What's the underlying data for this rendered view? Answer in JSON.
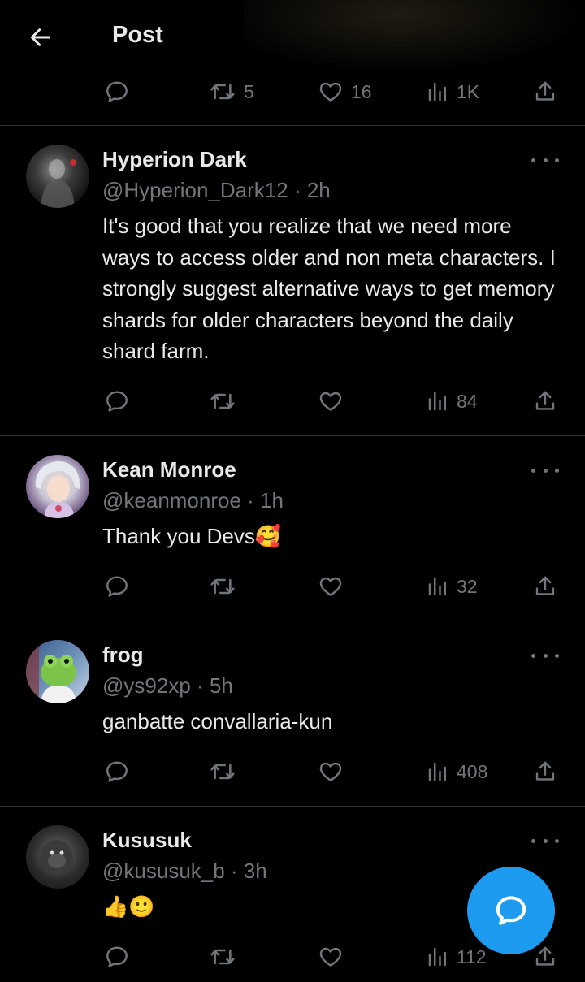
{
  "header": {
    "title": "Post",
    "back_icon": "arrow-left-icon"
  },
  "top_actions": {
    "reply": "",
    "repost": "5",
    "like": "16",
    "views": "1K"
  },
  "tweets": [
    {
      "name": "Hyperion Dark",
      "handle": "@Hyperion_Dark12 · 2h",
      "text": "It's good that you realize that we need more ways to access older and non meta characters. I strongly suggest alternative ways to get memory shards for older characters beyond the daily shard farm.",
      "views": "84"
    },
    {
      "name": "Kean Monroe",
      "handle": "@keanmonroe · 1h",
      "text": "Thank you Devs🥰",
      "views": "32"
    },
    {
      "name": "frog",
      "handle": "@ys92xp · 5h",
      "text": "ganbatte convallaria-kun",
      "views": "408"
    },
    {
      "name": "Kususuk",
      "handle": "@kususuk_b · 3h",
      "text": "👍🙂",
      "views": "112"
    }
  ],
  "colors": {
    "background": "#000000",
    "text": "#e7e9ea",
    "muted": "#71767b",
    "accent": "#1d9bf0",
    "divider": "#2f3336"
  }
}
